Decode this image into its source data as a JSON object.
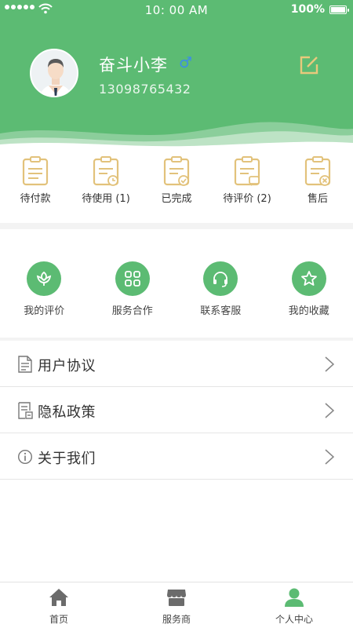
{
  "status_bar": {
    "time": "10:  00 AM",
    "battery": "100%"
  },
  "profile": {
    "name": "奋斗小李",
    "gender_symbol": "♂",
    "phone": "13098765432",
    "edit_icon": "edit-icon"
  },
  "orders": [
    {
      "label": "待付款",
      "icon": "clipboard-icon"
    },
    {
      "label": "待使用 (1)",
      "icon": "clipboard-clock-icon"
    },
    {
      "label": "已完成",
      "icon": "clipboard-check-icon"
    },
    {
      "label": "待评价 (2)",
      "icon": "clipboard-chat-icon"
    },
    {
      "label": "售后",
      "icon": "clipboard-x-icon"
    }
  ],
  "services": [
    {
      "label": "我的评价",
      "icon": "flower-icon"
    },
    {
      "label": "服务合作",
      "icon": "grid-icon"
    },
    {
      "label": "联系客服",
      "icon": "headset-icon"
    },
    {
      "label": "我的收藏",
      "icon": "star-icon"
    }
  ],
  "menu": [
    {
      "label": "用户协议",
      "icon": "document-icon"
    },
    {
      "label": "隐私政策",
      "icon": "policy-document-icon"
    },
    {
      "label": "关于我们",
      "icon": "info-icon"
    }
  ],
  "tabbar": [
    {
      "label": "首页",
      "icon": "home-icon"
    },
    {
      "label": "服务商",
      "icon": "store-icon"
    },
    {
      "label": "个人中心",
      "icon": "person-icon",
      "active": true
    }
  ],
  "colors": {
    "primary": "#5cbb73",
    "order_icon": "#e2c27b",
    "tab_inactive": "#6b6b6b"
  }
}
